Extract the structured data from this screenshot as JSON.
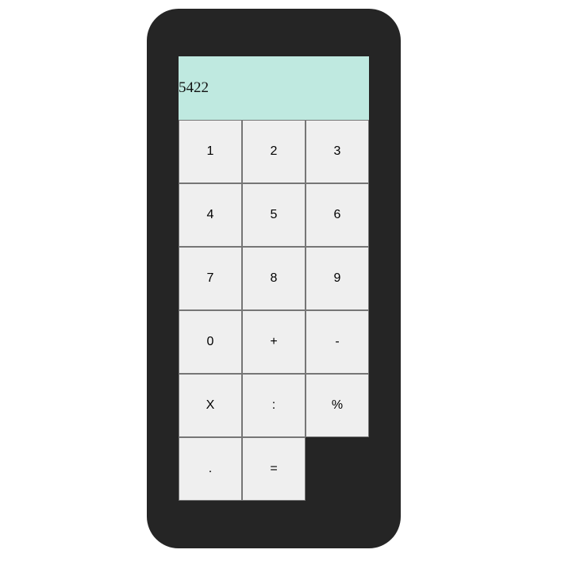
{
  "display": {
    "value": "5422"
  },
  "keys": [
    {
      "label": "1"
    },
    {
      "label": "2"
    },
    {
      "label": "3"
    },
    {
      "label": "4"
    },
    {
      "label": "5"
    },
    {
      "label": "6"
    },
    {
      "label": "7"
    },
    {
      "label": "8"
    },
    {
      "label": "9"
    },
    {
      "label": "0"
    },
    {
      "label": "+"
    },
    {
      "label": "-"
    },
    {
      "label": "X"
    },
    {
      "label": ":"
    },
    {
      "label": "%"
    },
    {
      "label": "."
    },
    {
      "label": "="
    }
  ],
  "colors": {
    "body": "#252525",
    "display": "#bfe9e0",
    "key": "#efefef"
  }
}
